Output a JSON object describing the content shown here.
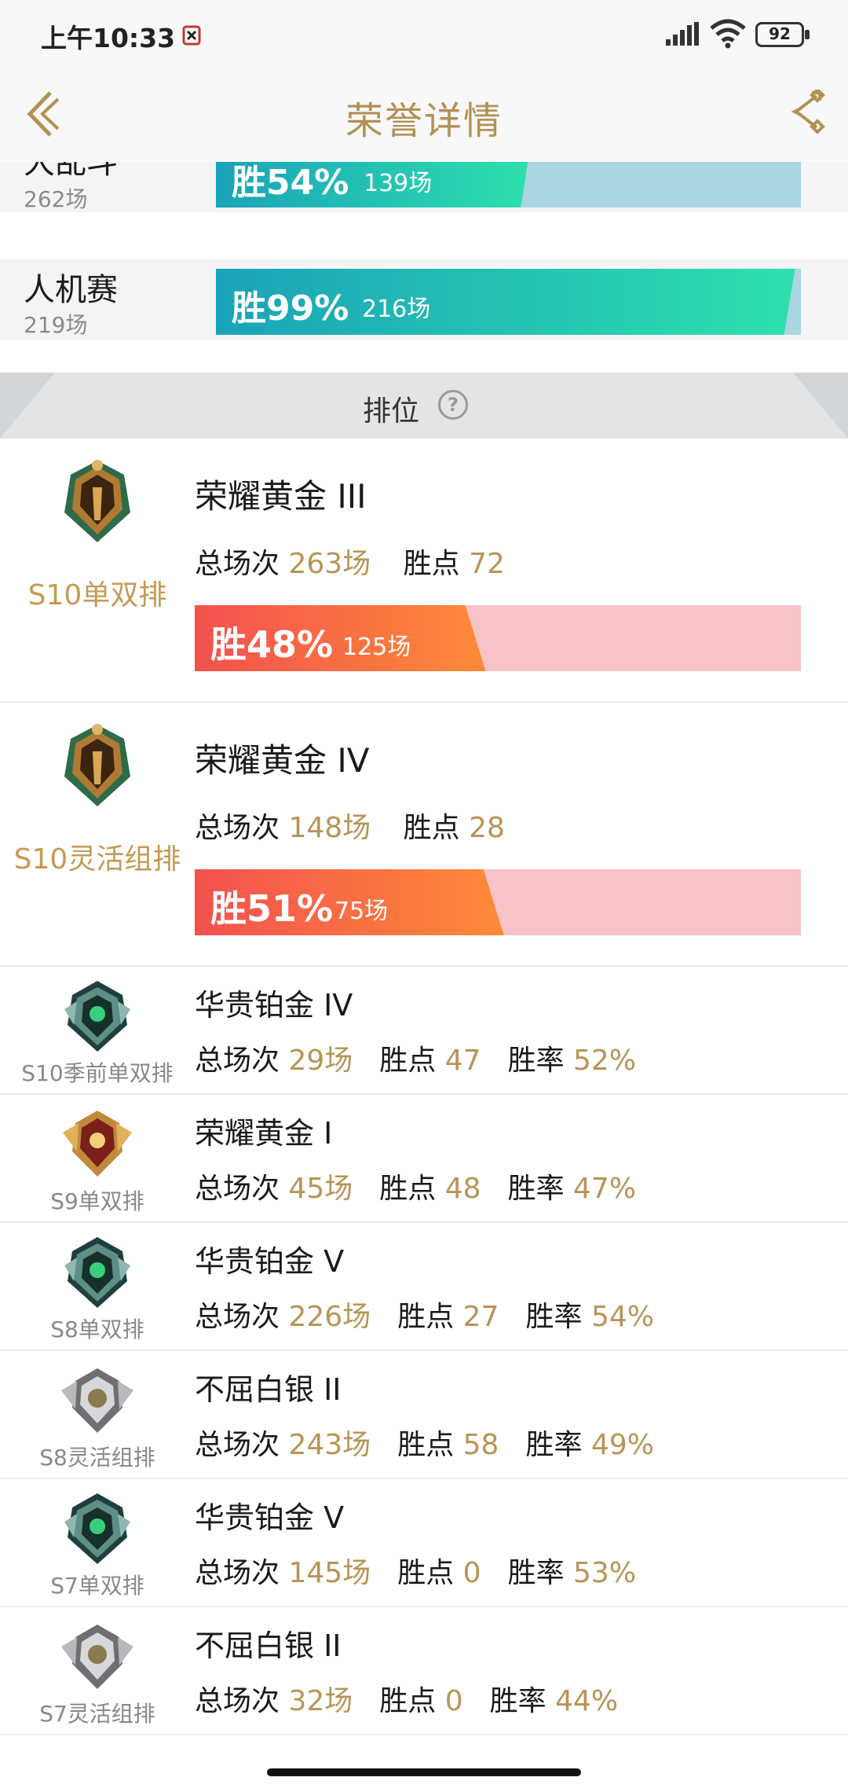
{
  "status_bar": {
    "time": "上午10:33",
    "battery": "92"
  },
  "header": {
    "title": "荣誉详情"
  },
  "modes": [
    {
      "name": "大乱斗",
      "count": "262场",
      "win": "胜54%",
      "games": "139场",
      "win_fraction": 0.54
    },
    {
      "name": "人机赛",
      "count": "219场",
      "win": "胜99%",
      "games": "216场",
      "win_fraction": 0.99
    }
  ],
  "rank_section": {
    "label": "排位",
    "help": "?"
  },
  "big_ranks": [
    {
      "season": "S10单双排",
      "rank": "荣耀黄金 III",
      "total_label": "总场次",
      "total": "263场",
      "points_label": "胜点",
      "points": "72",
      "win": "胜48%",
      "games": "125场",
      "win_fraction": 0.48
    },
    {
      "season": "S10灵活组排",
      "rank": "荣耀黄金 IV",
      "total_label": "总场次",
      "total": "148场",
      "points_label": "胜点",
      "points": "28",
      "win": "胜51%",
      "games": "75场",
      "win_fraction": 0.51
    }
  ],
  "small_ranks": [
    {
      "season": "S10季前单双排",
      "rank": "华贵铂金 IV",
      "total_label": "总场次",
      "total": "29场",
      "points_label": "胜点",
      "points": "47",
      "rate_label": "胜率",
      "rate": "52%",
      "emblem": "platinum-emblem-icon"
    },
    {
      "season": "S9单双排",
      "rank": "荣耀黄金 I",
      "total_label": "总场次",
      "total": "45场",
      "points_label": "胜点",
      "points": "48",
      "rate_label": "胜率",
      "rate": "47%",
      "emblem": "gold-emblem-icon"
    },
    {
      "season": "S8单双排",
      "rank": "华贵铂金 V",
      "total_label": "总场次",
      "total": "226场",
      "points_label": "胜点",
      "points": "27",
      "rate_label": "胜率",
      "rate": "54%",
      "emblem": "platinum-emblem-icon"
    },
    {
      "season": "S8灵活组排",
      "rank": "不屈白银 II",
      "total_label": "总场次",
      "total": "243场",
      "points_label": "胜点",
      "points": "58",
      "rate_label": "胜率",
      "rate": "49%",
      "emblem": "silver-emblem-icon"
    },
    {
      "season": "S7单双排",
      "rank": "华贵铂金 V",
      "total_label": "总场次",
      "total": "145场",
      "points_label": "胜点",
      "points": "0",
      "rate_label": "胜率",
      "rate": "53%",
      "emblem": "platinum-emblem-icon"
    },
    {
      "season": "S7灵活组排",
      "rank": "不屈白银 II",
      "total_label": "总场次",
      "total": "32场",
      "points_label": "胜点",
      "points": "0",
      "rate_label": "胜率",
      "rate": "44%",
      "emblem": "silver-emblem-icon"
    }
  ],
  "colors": {
    "accent": "#b29155",
    "value": "#b89456",
    "mode_bar": "#2ee0ad",
    "rank_bar": "#f3514f"
  }
}
